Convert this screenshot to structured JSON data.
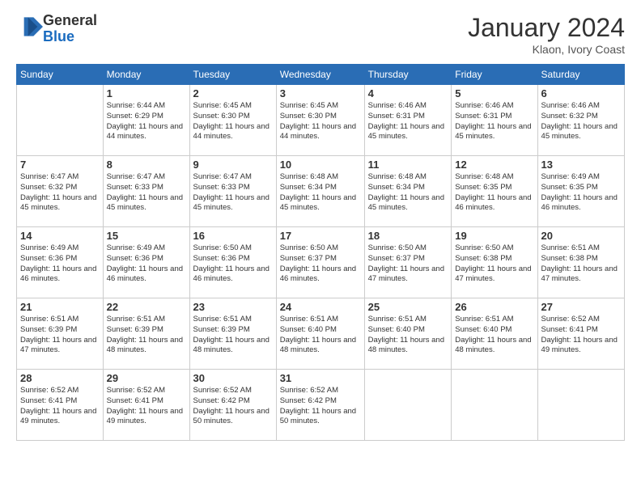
{
  "header": {
    "logo_line1": "General",
    "logo_line2": "Blue",
    "month_year": "January 2024",
    "location": "Klaon, Ivory Coast"
  },
  "weekdays": [
    "Sunday",
    "Monday",
    "Tuesday",
    "Wednesday",
    "Thursday",
    "Friday",
    "Saturday"
  ],
  "weeks": [
    [
      {
        "day": "",
        "sunrise": "",
        "sunset": "",
        "daylight": ""
      },
      {
        "day": "1",
        "sunrise": "Sunrise: 6:44 AM",
        "sunset": "Sunset: 6:29 PM",
        "daylight": "Daylight: 11 hours and 44 minutes."
      },
      {
        "day": "2",
        "sunrise": "Sunrise: 6:45 AM",
        "sunset": "Sunset: 6:30 PM",
        "daylight": "Daylight: 11 hours and 44 minutes."
      },
      {
        "day": "3",
        "sunrise": "Sunrise: 6:45 AM",
        "sunset": "Sunset: 6:30 PM",
        "daylight": "Daylight: 11 hours and 44 minutes."
      },
      {
        "day": "4",
        "sunrise": "Sunrise: 6:46 AM",
        "sunset": "Sunset: 6:31 PM",
        "daylight": "Daylight: 11 hours and 45 minutes."
      },
      {
        "day": "5",
        "sunrise": "Sunrise: 6:46 AM",
        "sunset": "Sunset: 6:31 PM",
        "daylight": "Daylight: 11 hours and 45 minutes."
      },
      {
        "day": "6",
        "sunrise": "Sunrise: 6:46 AM",
        "sunset": "Sunset: 6:32 PM",
        "daylight": "Daylight: 11 hours and 45 minutes."
      }
    ],
    [
      {
        "day": "7",
        "sunrise": "Sunrise: 6:47 AM",
        "sunset": "Sunset: 6:32 PM",
        "daylight": "Daylight: 11 hours and 45 minutes."
      },
      {
        "day": "8",
        "sunrise": "Sunrise: 6:47 AM",
        "sunset": "Sunset: 6:33 PM",
        "daylight": "Daylight: 11 hours and 45 minutes."
      },
      {
        "day": "9",
        "sunrise": "Sunrise: 6:47 AM",
        "sunset": "Sunset: 6:33 PM",
        "daylight": "Daylight: 11 hours and 45 minutes."
      },
      {
        "day": "10",
        "sunrise": "Sunrise: 6:48 AM",
        "sunset": "Sunset: 6:34 PM",
        "daylight": "Daylight: 11 hours and 45 minutes."
      },
      {
        "day": "11",
        "sunrise": "Sunrise: 6:48 AM",
        "sunset": "Sunset: 6:34 PM",
        "daylight": "Daylight: 11 hours and 45 minutes."
      },
      {
        "day": "12",
        "sunrise": "Sunrise: 6:48 AM",
        "sunset": "Sunset: 6:35 PM",
        "daylight": "Daylight: 11 hours and 46 minutes."
      },
      {
        "day": "13",
        "sunrise": "Sunrise: 6:49 AM",
        "sunset": "Sunset: 6:35 PM",
        "daylight": "Daylight: 11 hours and 46 minutes."
      }
    ],
    [
      {
        "day": "14",
        "sunrise": "Sunrise: 6:49 AM",
        "sunset": "Sunset: 6:36 PM",
        "daylight": "Daylight: 11 hours and 46 minutes."
      },
      {
        "day": "15",
        "sunrise": "Sunrise: 6:49 AM",
        "sunset": "Sunset: 6:36 PM",
        "daylight": "Daylight: 11 hours and 46 minutes."
      },
      {
        "day": "16",
        "sunrise": "Sunrise: 6:50 AM",
        "sunset": "Sunset: 6:36 PM",
        "daylight": "Daylight: 11 hours and 46 minutes."
      },
      {
        "day": "17",
        "sunrise": "Sunrise: 6:50 AM",
        "sunset": "Sunset: 6:37 PM",
        "daylight": "Daylight: 11 hours and 46 minutes."
      },
      {
        "day": "18",
        "sunrise": "Sunrise: 6:50 AM",
        "sunset": "Sunset: 6:37 PM",
        "daylight": "Daylight: 11 hours and 47 minutes."
      },
      {
        "day": "19",
        "sunrise": "Sunrise: 6:50 AM",
        "sunset": "Sunset: 6:38 PM",
        "daylight": "Daylight: 11 hours and 47 minutes."
      },
      {
        "day": "20",
        "sunrise": "Sunrise: 6:51 AM",
        "sunset": "Sunset: 6:38 PM",
        "daylight": "Daylight: 11 hours and 47 minutes."
      }
    ],
    [
      {
        "day": "21",
        "sunrise": "Sunrise: 6:51 AM",
        "sunset": "Sunset: 6:39 PM",
        "daylight": "Daylight: 11 hours and 47 minutes."
      },
      {
        "day": "22",
        "sunrise": "Sunrise: 6:51 AM",
        "sunset": "Sunset: 6:39 PM",
        "daylight": "Daylight: 11 hours and 48 minutes."
      },
      {
        "day": "23",
        "sunrise": "Sunrise: 6:51 AM",
        "sunset": "Sunset: 6:39 PM",
        "daylight": "Daylight: 11 hours and 48 minutes."
      },
      {
        "day": "24",
        "sunrise": "Sunrise: 6:51 AM",
        "sunset": "Sunset: 6:40 PM",
        "daylight": "Daylight: 11 hours and 48 minutes."
      },
      {
        "day": "25",
        "sunrise": "Sunrise: 6:51 AM",
        "sunset": "Sunset: 6:40 PM",
        "daylight": "Daylight: 11 hours and 48 minutes."
      },
      {
        "day": "26",
        "sunrise": "Sunrise: 6:51 AM",
        "sunset": "Sunset: 6:40 PM",
        "daylight": "Daylight: 11 hours and 48 minutes."
      },
      {
        "day": "27",
        "sunrise": "Sunrise: 6:52 AM",
        "sunset": "Sunset: 6:41 PM",
        "daylight": "Daylight: 11 hours and 49 minutes."
      }
    ],
    [
      {
        "day": "28",
        "sunrise": "Sunrise: 6:52 AM",
        "sunset": "Sunset: 6:41 PM",
        "daylight": "Daylight: 11 hours and 49 minutes."
      },
      {
        "day": "29",
        "sunrise": "Sunrise: 6:52 AM",
        "sunset": "Sunset: 6:41 PM",
        "daylight": "Daylight: 11 hours and 49 minutes."
      },
      {
        "day": "30",
        "sunrise": "Sunrise: 6:52 AM",
        "sunset": "Sunset: 6:42 PM",
        "daylight": "Daylight: 11 hours and 50 minutes."
      },
      {
        "day": "31",
        "sunrise": "Sunrise: 6:52 AM",
        "sunset": "Sunset: 6:42 PM",
        "daylight": "Daylight: 11 hours and 50 minutes."
      },
      {
        "day": "",
        "sunrise": "",
        "sunset": "",
        "daylight": ""
      },
      {
        "day": "",
        "sunrise": "",
        "sunset": "",
        "daylight": ""
      },
      {
        "day": "",
        "sunrise": "",
        "sunset": "",
        "daylight": ""
      }
    ]
  ]
}
